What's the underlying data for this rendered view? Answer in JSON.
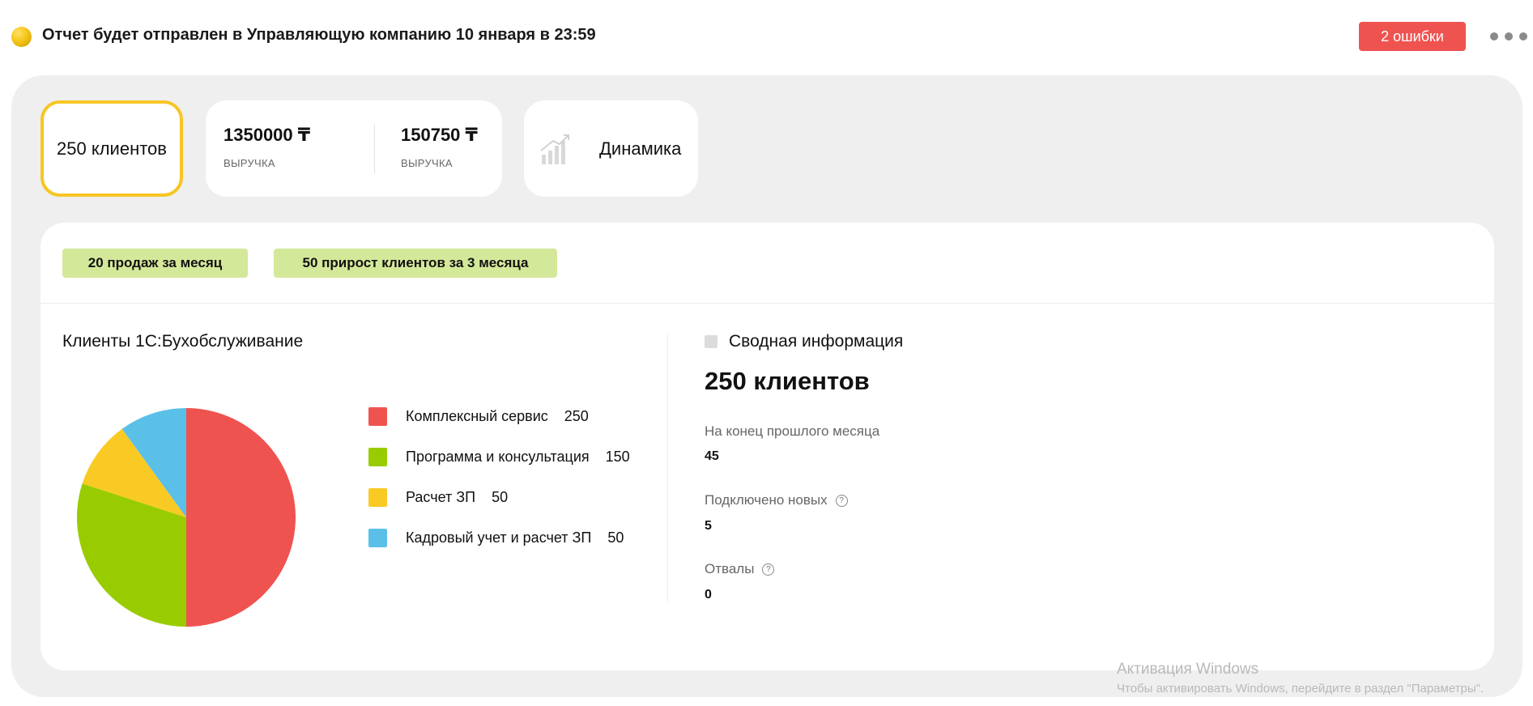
{
  "header": {
    "title": "Отчет будет отправлен в Управляющую компанию 10 января в 23:59",
    "errors_label": "2 ошибки",
    "status_color": "#f5c518",
    "errors_color": "#ef5350"
  },
  "cards": {
    "clients": "250 клиентов",
    "revenue": [
      {
        "value": "1350000 ₸",
        "label": "ВЫРУЧКА"
      },
      {
        "value": "150750 ₸",
        "label": "ВЫРУЧКА"
      }
    ],
    "dynamics_label": "Динамика",
    "dynamics_icon": "bar-growth-icon",
    "active_border_color": "#f7c625"
  },
  "tags": {
    "sales": "20 продаж за месяц",
    "growth": "50 прирост клиентов за 3 месяца",
    "color": "#d4e89a"
  },
  "chart_panel": {
    "title": "Клиенты 1С:Бухобслуживание"
  },
  "chart_data": {
    "type": "pie",
    "slices": [
      {
        "label": "Комплексный сервис",
        "value": 250,
        "color": "#ef5350"
      },
      {
        "label": "Программа и консультация",
        "value": 150,
        "color": "#99cc00"
      },
      {
        "label": "Расчет ЗП",
        "value": 50,
        "color": "#f9ca24"
      },
      {
        "label": "Кадровый учет и расчет ЗП",
        "value": 50,
        "color": "#5bc0e8"
      }
    ],
    "legend_position": "right"
  },
  "summary": {
    "title": "Сводная информация",
    "big_value": "250 клиентов",
    "stats": [
      {
        "label": "На конец прошлого месяца",
        "value": "45"
      },
      {
        "label": "Подключено новых",
        "value": "5"
      },
      {
        "label": "Отвалы",
        "value": "0"
      }
    ]
  },
  "watermark": {
    "title": "Активация Windows",
    "subtitle": "Чтобы активировать Windows, перейдите в раздел \"Параметры\"."
  }
}
